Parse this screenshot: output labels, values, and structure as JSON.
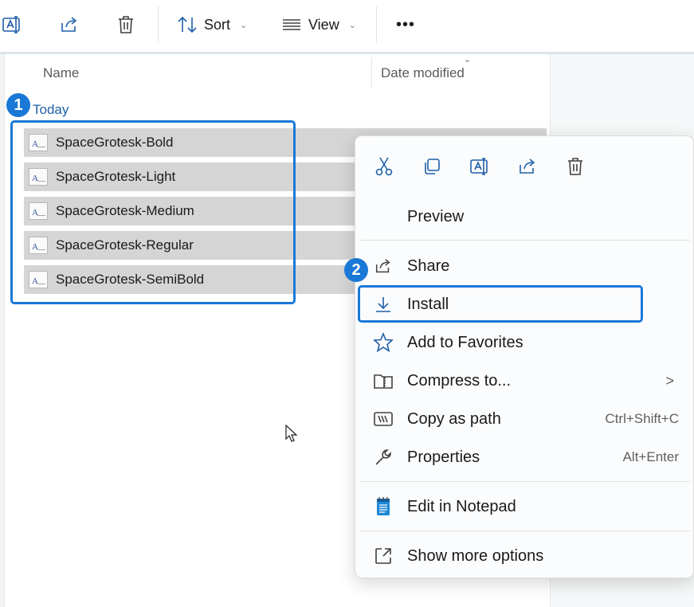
{
  "toolbar": {
    "sort_label": "Sort",
    "view_label": "View",
    "more_label": "•••"
  },
  "columns": {
    "name": "Name",
    "date_modified": "Date modified"
  },
  "group": {
    "title": "Today"
  },
  "files": [
    {
      "name": "SpaceGrotesk-Bold"
    },
    {
      "name": "SpaceGrotesk-Light"
    },
    {
      "name": "SpaceGrotesk-Medium"
    },
    {
      "name": "SpaceGrotesk-Regular"
    },
    {
      "name": "SpaceGrotesk-SemiBold"
    }
  ],
  "badges": {
    "step1": "1",
    "step2": "2"
  },
  "context_menu": {
    "quick_actions": [
      "cut-icon",
      "copy-icon",
      "rename-icon",
      "share-icon",
      "delete-icon"
    ],
    "items": [
      {
        "label": "Preview",
        "icon": "none",
        "shortcut": ""
      },
      {
        "label": "Share",
        "icon": "share-icon",
        "shortcut": ""
      },
      {
        "label": "Install",
        "icon": "download-icon",
        "shortcut": ""
      },
      {
        "label": "Add to Favorites",
        "icon": "star-icon",
        "shortcut": ""
      },
      {
        "label": "Compress to...",
        "icon": "zip-folder-icon",
        "shortcut": "",
        "submenu": ">"
      },
      {
        "label": "Copy as path",
        "icon": "path-icon",
        "shortcut": "Ctrl+Shift+C"
      },
      {
        "label": "Properties",
        "icon": "wrench-icon",
        "shortcut": "Alt+Enter"
      },
      {
        "label": "Edit in Notepad",
        "icon": "notepad-icon",
        "shortcut": ""
      },
      {
        "label": "Show more options",
        "icon": "expand-icon",
        "shortcut": ""
      }
    ]
  },
  "colors": {
    "accent": "#1a78d6",
    "selection": "#d5d5d5",
    "group_title": "#1f5fa8"
  }
}
